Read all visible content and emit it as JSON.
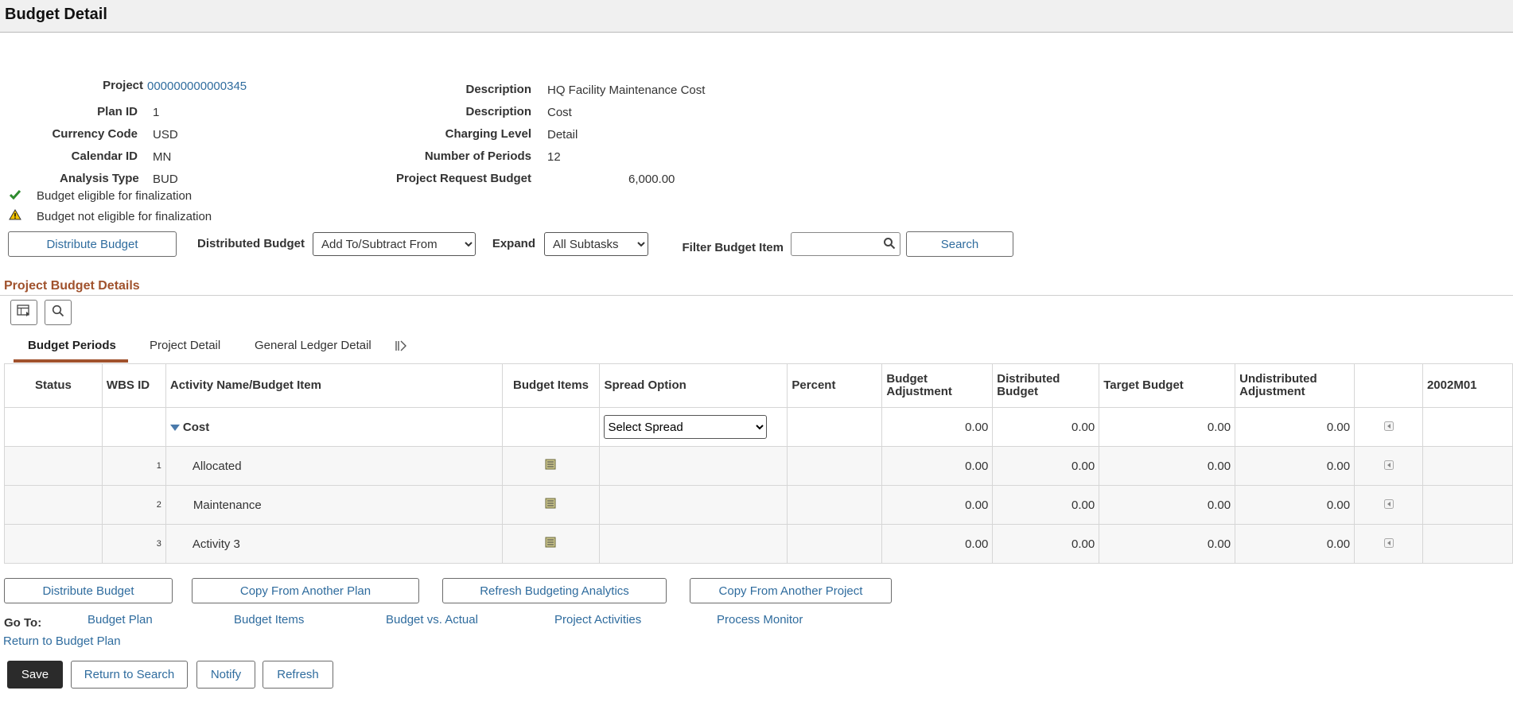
{
  "page": {
    "title": "Budget Detail"
  },
  "summary": {
    "project_label": "Project",
    "project_value": "000000000000345",
    "plan_label": "Plan ID",
    "plan_value": "1",
    "currency_label": "Currency Code",
    "currency_value": "USD",
    "calendar_label": "Calendar ID",
    "calendar_value": "MN",
    "analysis_label": "Analysis Type",
    "analysis_value": "BUD",
    "desc1_label": "Description",
    "desc1_value": "HQ Facility Maintenance Cost",
    "desc2_label": "Description",
    "desc2_value": "Cost",
    "charging_label": "Charging Level",
    "charging_value": "Detail",
    "periods_label": "Number of Periods",
    "periods_value": "12",
    "request_label": "Project Request Budget",
    "request_value": "6,000.00"
  },
  "messages": {
    "eligible": "Budget eligible for finalization",
    "not_eligible": "Budget not eligible for finalization"
  },
  "toolbar": {
    "distribute_label": "Distribute Budget",
    "distributed_label": "Distributed Budget",
    "distributed_option": "Add To/Subtract From",
    "expand_label": "Expand",
    "expand_option": "All Subtasks",
    "filter_label": "Filter Budget Item",
    "filter_value": "",
    "search_label": "Search"
  },
  "section": {
    "title": "Project Budget Details"
  },
  "tabs": [
    {
      "label": "Budget Periods"
    },
    {
      "label": "Project Detail"
    },
    {
      "label": "General Ledger Detail"
    }
  ],
  "grid": {
    "headers": {
      "status": "Status",
      "wbs": "WBS ID",
      "activity": "Activity Name/Budget Item",
      "items": "Budget Items",
      "spread": "Spread Option",
      "percent": "Percent",
      "adj1": "Budget",
      "adj2": "Adjustment",
      "dist1": "Distributed",
      "dist2": "Budget",
      "target": "Target Budget",
      "undist1": "Undistributed",
      "undist2": "Adjustment",
      "period": "2002M01"
    },
    "parent": {
      "name": "Cost",
      "spread": "Select Spread",
      "adj": "0.00",
      "dist": "0.00",
      "target": "0.00",
      "undist": "0.00"
    },
    "rows": [
      {
        "wbs": "1",
        "name": "Allocated",
        "adj": "0.00",
        "dist": "0.00",
        "target": "0.00",
        "undist": "0.00"
      },
      {
        "wbs": "2",
        "name": "Maintenance",
        "adj": "0.00",
        "dist": "0.00",
        "target": "0.00",
        "undist": "0.00"
      },
      {
        "wbs": "3",
        "name": "Activity 3",
        "adj": "0.00",
        "dist": "0.00",
        "target": "0.00",
        "undist": "0.00"
      }
    ]
  },
  "actions": {
    "distribute": "Distribute Budget",
    "copy_plan": "Copy From Another Plan",
    "refresh_analytics": "Refresh Budgeting Analytics",
    "copy_project": "Copy From Another Project"
  },
  "goto": {
    "label": "Go To:",
    "budget_plan": "Budget Plan",
    "budget_items": "Budget Items",
    "budget_vs_actual": "Budget vs. Actual",
    "project_activities": "Project Activities",
    "process_monitor": "Process Monitor",
    "return_plan": "Return to Budget Plan"
  },
  "footer": {
    "save": "Save",
    "return_search": "Return to Search",
    "notify": "Notify",
    "refresh": "Refresh"
  },
  "colors": {
    "accent": "#a0522d",
    "link": "#2f6c9e",
    "check": "#2e8b2e",
    "warning": "#f2c200"
  }
}
